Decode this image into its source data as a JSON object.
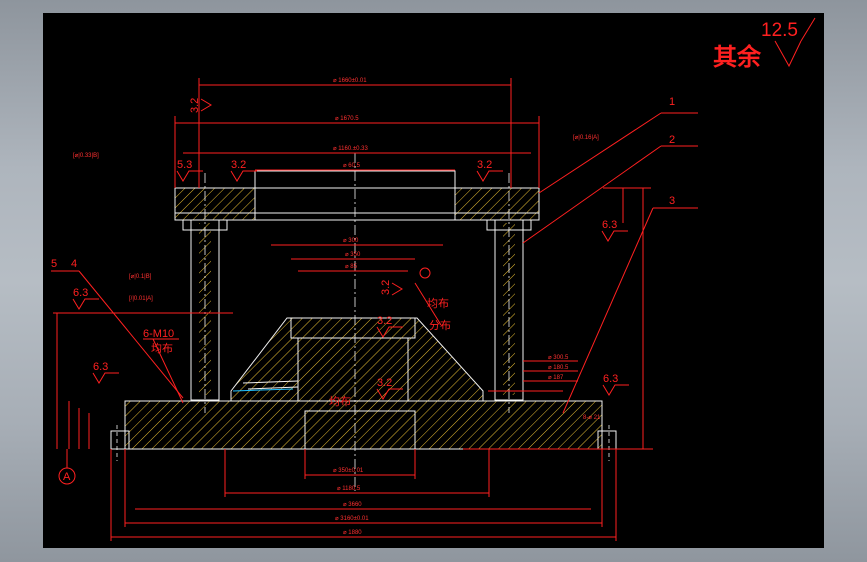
{
  "surface_finish_note": {
    "text": "其余",
    "value": "12.5"
  },
  "part_labels": [
    "1",
    "2",
    "3",
    "5",
    "4"
  ],
  "roughness_marks": [
    "3.2",
    "3.2",
    "3.2",
    "5.3",
    "3.2",
    "3.2",
    "6.3",
    "6.3",
    "6.3",
    "6.3",
    "3.2"
  ],
  "callouts": {
    "six_m10": "6-M10",
    "evenly_1": "均布",
    "evenly_2": "均布",
    "evenly_3": "分布",
    "evenly_4": "均布",
    "datum": "A"
  },
  "colors": {
    "background": "#000000",
    "dimension": "#ff2020",
    "outline": "#f2f2f2",
    "hatch": "#ffd23a",
    "leader": "#22c3ff"
  }
}
